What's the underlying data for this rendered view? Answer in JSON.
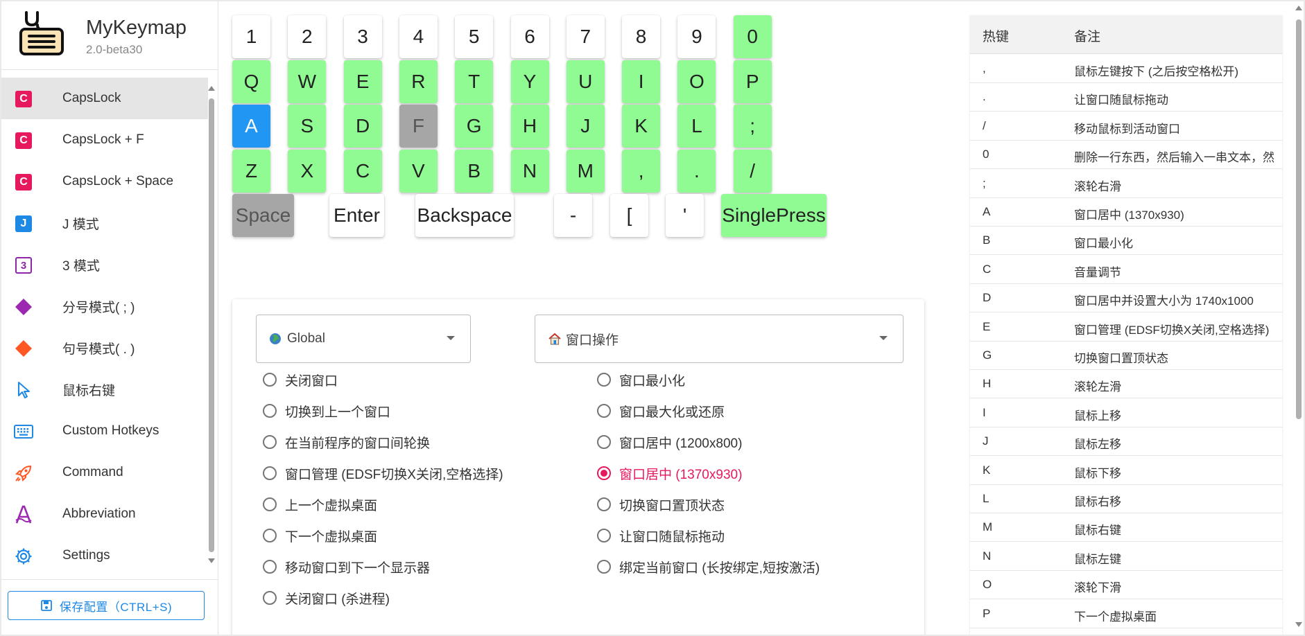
{
  "app": {
    "title": "MyKeymap",
    "version": "2.0-beta30"
  },
  "sidebar": {
    "items": [
      {
        "label": "CapsLock",
        "icon": "capslock-c-icon",
        "active": true
      },
      {
        "label": "CapsLock + F",
        "icon": "capslock-c-icon"
      },
      {
        "label": "CapsLock + Space",
        "icon": "capslock-c-icon"
      },
      {
        "label": "J 模式",
        "icon": "j-mode-icon"
      },
      {
        "label": "3 模式",
        "icon": "three-mode-icon"
      },
      {
        "label": "分号模式( ; )",
        "icon": "purple-diamond-icon"
      },
      {
        "label": "句号模式( . )",
        "icon": "orange-diamond-icon"
      },
      {
        "label": "鼠标右键",
        "icon": "mouse-pointer-icon"
      },
      {
        "label": "Custom Hotkeys",
        "icon": "keyboard-icon"
      },
      {
        "label": "Command",
        "icon": "rocket-icon"
      },
      {
        "label": "Abbreviation",
        "icon": "abbreviation-a-icon"
      },
      {
        "label": "Settings",
        "icon": "gear-icon"
      }
    ],
    "save_label": "保存配置（CTRL+S)"
  },
  "keyboard": {
    "row1": [
      {
        "label": "1",
        "state": "normal"
      },
      {
        "label": "2",
        "state": "normal"
      },
      {
        "label": "3",
        "state": "normal"
      },
      {
        "label": "4",
        "state": "normal"
      },
      {
        "label": "5",
        "state": "normal"
      },
      {
        "label": "6",
        "state": "normal"
      },
      {
        "label": "7",
        "state": "normal"
      },
      {
        "label": "8",
        "state": "normal"
      },
      {
        "label": "9",
        "state": "normal"
      },
      {
        "label": "0",
        "state": "mapped"
      }
    ],
    "row2": [
      {
        "label": "Q",
        "state": "mapped"
      },
      {
        "label": "W",
        "state": "mapped"
      },
      {
        "label": "E",
        "state": "mapped"
      },
      {
        "label": "R",
        "state": "mapped"
      },
      {
        "label": "T",
        "state": "mapped"
      },
      {
        "label": "Y",
        "state": "mapped"
      },
      {
        "label": "U",
        "state": "mapped"
      },
      {
        "label": "I",
        "state": "mapped"
      },
      {
        "label": "O",
        "state": "mapped"
      },
      {
        "label": "P",
        "state": "mapped"
      }
    ],
    "row3": [
      {
        "label": "A",
        "state": "selected"
      },
      {
        "label": "S",
        "state": "mapped"
      },
      {
        "label": "D",
        "state": "mapped"
      },
      {
        "label": "F",
        "state": "disabled"
      },
      {
        "label": "G",
        "state": "mapped"
      },
      {
        "label": "H",
        "state": "mapped"
      },
      {
        "label": "J",
        "state": "mapped"
      },
      {
        "label": "K",
        "state": "mapped"
      },
      {
        "label": "L",
        "state": "mapped"
      },
      {
        "label": ";",
        "state": "mapped"
      }
    ],
    "row4": [
      {
        "label": "Z",
        "state": "mapped"
      },
      {
        "label": "X",
        "state": "mapped"
      },
      {
        "label": "C",
        "state": "mapped"
      },
      {
        "label": "V",
        "state": "mapped"
      },
      {
        "label": "B",
        "state": "mapped"
      },
      {
        "label": "N",
        "state": "mapped"
      },
      {
        "label": "M",
        "state": "mapped"
      },
      {
        "label": ",",
        "state": "mapped"
      },
      {
        "label": ".",
        "state": "mapped"
      },
      {
        "label": "/",
        "state": "mapped"
      }
    ],
    "row5": [
      {
        "label": "Space",
        "state": "disabled"
      },
      {
        "label": "Enter",
        "state": "normal"
      },
      {
        "label": "Backspace",
        "state": "normal"
      },
      {
        "label": "-",
        "state": "normal"
      },
      {
        "label": "[",
        "state": "normal"
      },
      {
        "label": "'",
        "state": "normal"
      },
      {
        "label": "SinglePress",
        "state": "mapped"
      }
    ]
  },
  "config": {
    "scope_select": {
      "value": "Global",
      "icon": "globe-icon"
    },
    "category_select": {
      "value": "窗口操作",
      "icon": "house-icon"
    },
    "options_left": [
      "关闭窗口",
      "切换到上一个窗口",
      "在当前程序的窗口间轮换",
      "窗口管理 (EDSF切换X关闭,空格选择)",
      "上一个虚拟桌面",
      "下一个虚拟桌面",
      "移动窗口到下一个显示器",
      "关闭窗口 (杀进程)"
    ],
    "options_right": [
      "窗口最小化",
      "窗口最大化或还原",
      "窗口居中 (1200x800)",
      "窗口居中 (1370x930)",
      "切换窗口置顶状态",
      "让窗口随鼠标拖动",
      "绑定当前窗口 (长按绑定,短按激活)"
    ],
    "selected_option": "窗口居中 (1370x930)"
  },
  "hotkey_table": {
    "headers": {
      "key": "热键",
      "note": "备注"
    },
    "rows": [
      {
        "key": ",",
        "note": "鼠标左键按下 (之后按空格松开)"
      },
      {
        "key": ".",
        "note": "让窗口随鼠标拖动"
      },
      {
        "key": "/",
        "note": "移动鼠标到活动窗口"
      },
      {
        "key": "0",
        "note": "删除一行东西，然后输入一串文本，然"
      },
      {
        "key": ";",
        "note": "滚轮右滑"
      },
      {
        "key": "A",
        "note": "窗口居中 (1370x930)"
      },
      {
        "key": "B",
        "note": "窗口最小化"
      },
      {
        "key": "C",
        "note": "音量调节"
      },
      {
        "key": "D",
        "note": "窗口居中并设置大小为 1740x1000"
      },
      {
        "key": "E",
        "note": "窗口管理 (EDSF切换X关闭,空格选择)"
      },
      {
        "key": "G",
        "note": "切换窗口置顶状态"
      },
      {
        "key": "H",
        "note": "滚轮左滑"
      },
      {
        "key": "I",
        "note": "鼠标上移"
      },
      {
        "key": "J",
        "note": "鼠标左移"
      },
      {
        "key": "K",
        "note": "鼠标下移"
      },
      {
        "key": "L",
        "note": "鼠标右移"
      },
      {
        "key": "M",
        "note": "鼠标右键"
      },
      {
        "key": "N",
        "note": "鼠标左键"
      },
      {
        "key": "O",
        "note": "滚轮下滑"
      },
      {
        "key": "P",
        "note": "下一个虚拟桌面"
      }
    ]
  },
  "colors": {
    "mapped_key": "#90fa93",
    "selected_key": "#2196f3",
    "disabled_key": "#a6a6a6",
    "accent_pink": "#e6195f",
    "accent_blue": "#1e88e5"
  }
}
